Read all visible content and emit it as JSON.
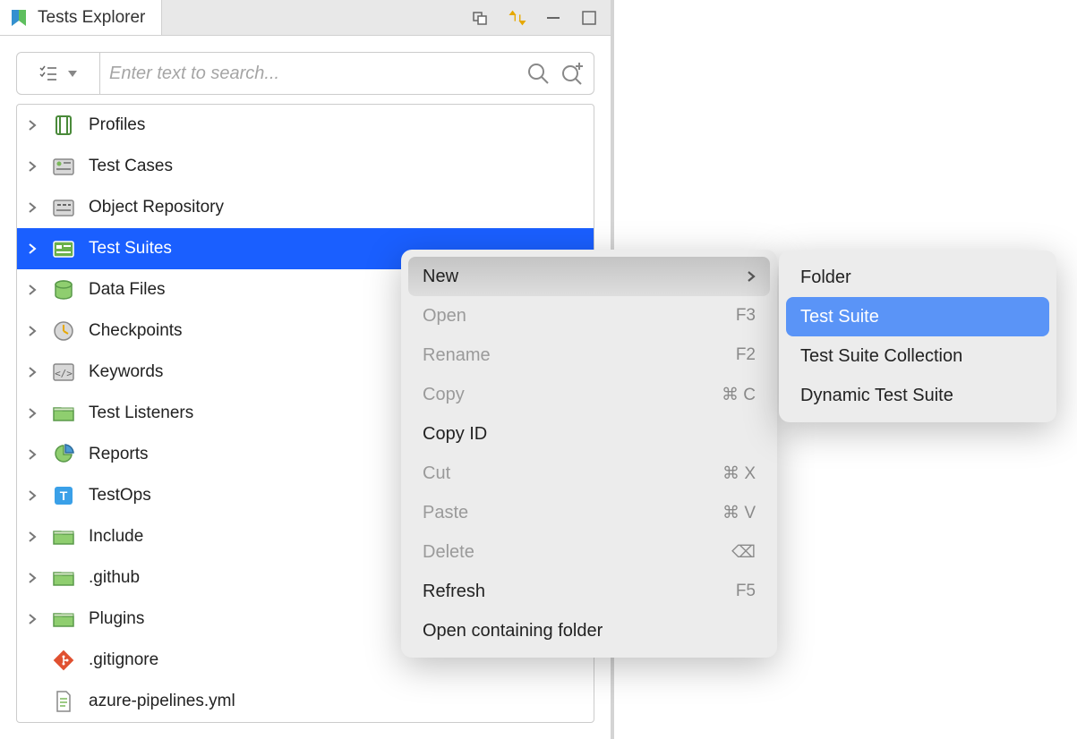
{
  "tab": {
    "title": "Tests Explorer"
  },
  "search": {
    "placeholder": "Enter text to search..."
  },
  "tree": {
    "items": [
      {
        "label": "Profiles",
        "icon": "profiles",
        "expandable": true
      },
      {
        "label": "Test Cases",
        "icon": "testcases",
        "expandable": true
      },
      {
        "label": "Object Repository",
        "icon": "objectrepo",
        "expandable": true
      },
      {
        "label": "Test Suites",
        "icon": "testsuites",
        "expandable": true,
        "selected": true
      },
      {
        "label": "Data Files",
        "icon": "datafiles",
        "expandable": true
      },
      {
        "label": "Checkpoints",
        "icon": "checkpoints",
        "expandable": true
      },
      {
        "label": "Keywords",
        "icon": "keywords",
        "expandable": true
      },
      {
        "label": "Test Listeners",
        "icon": "folder",
        "expandable": true
      },
      {
        "label": "Reports",
        "icon": "reports",
        "expandable": true
      },
      {
        "label": "TestOps",
        "icon": "testops",
        "expandable": true
      },
      {
        "label": "Include",
        "icon": "folder",
        "expandable": true
      },
      {
        "label": ".github",
        "icon": "folder",
        "expandable": true
      },
      {
        "label": "Plugins",
        "icon": "folder",
        "expandable": true
      },
      {
        "label": ".gitignore",
        "icon": "git",
        "expandable": false
      },
      {
        "label": "azure-pipelines.yml",
        "icon": "file",
        "expandable": false
      }
    ]
  },
  "context_menu": {
    "items": [
      {
        "label": "New",
        "shortcut": "",
        "enabled": true,
        "submenu": true,
        "highlight": true
      },
      {
        "label": "Open",
        "shortcut": "F3",
        "enabled": false
      },
      {
        "label": "Rename",
        "shortcut": "F2",
        "enabled": false
      },
      {
        "label": "Copy",
        "shortcut": "⌘ C",
        "enabled": false
      },
      {
        "label": "Copy ID",
        "shortcut": "",
        "enabled": true
      },
      {
        "label": "Cut",
        "shortcut": "⌘ X",
        "enabled": false
      },
      {
        "label": "Paste",
        "shortcut": "⌘ V",
        "enabled": false
      },
      {
        "label": "Delete",
        "shortcut": "⌫",
        "enabled": false
      },
      {
        "label": "Refresh",
        "shortcut": "F5",
        "enabled": true
      },
      {
        "label": "Open containing folder",
        "shortcut": "",
        "enabled": true
      }
    ]
  },
  "submenu": {
    "items": [
      {
        "label": "Folder",
        "highlight": false
      },
      {
        "label": "Test Suite",
        "highlight": true
      },
      {
        "label": "Test Suite Collection",
        "highlight": false
      },
      {
        "label": "Dynamic Test Suite",
        "highlight": false
      }
    ]
  }
}
